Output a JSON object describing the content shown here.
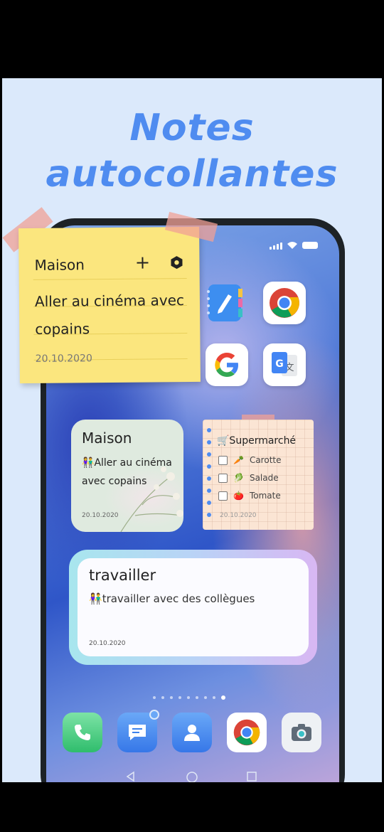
{
  "headline": {
    "line1": "Notes",
    "line2": "autocollantes"
  },
  "sticky_note": {
    "title": "Maison",
    "add_icon": "plus-icon",
    "settings_icon": "hexagon-settings-icon",
    "body": "Aller au cinéma avec copains",
    "date": "20.10.2020"
  },
  "widget_maison": {
    "title": "Maison",
    "emoji": "👫",
    "body": "Aller au cinéma avec copains",
    "date": "20.10.2020"
  },
  "widget_list": {
    "title": "🛒Supermarché",
    "items": [
      {
        "emoji": "🥕",
        "label": "Carotte"
      },
      {
        "emoji": "🥬",
        "label": "Salade"
      },
      {
        "emoji": "🍅",
        "label": "Tomate"
      }
    ],
    "date": "20.10.2020"
  },
  "widget_work": {
    "title": "travailler",
    "emoji": "👫",
    "body": "travailler avec des collègues",
    "date": "20.10.2020"
  },
  "apps": [
    "notes-app-icon",
    "chrome-icon",
    "google-icon",
    "google-translate-icon"
  ],
  "dock": [
    "phone-icon",
    "messages-icon",
    "contacts-icon",
    "chrome-icon",
    "camera-icon"
  ],
  "colors": {
    "accent": "#4f8cf0",
    "sticky": "#fbe67e",
    "background": "#dbe9fb"
  }
}
